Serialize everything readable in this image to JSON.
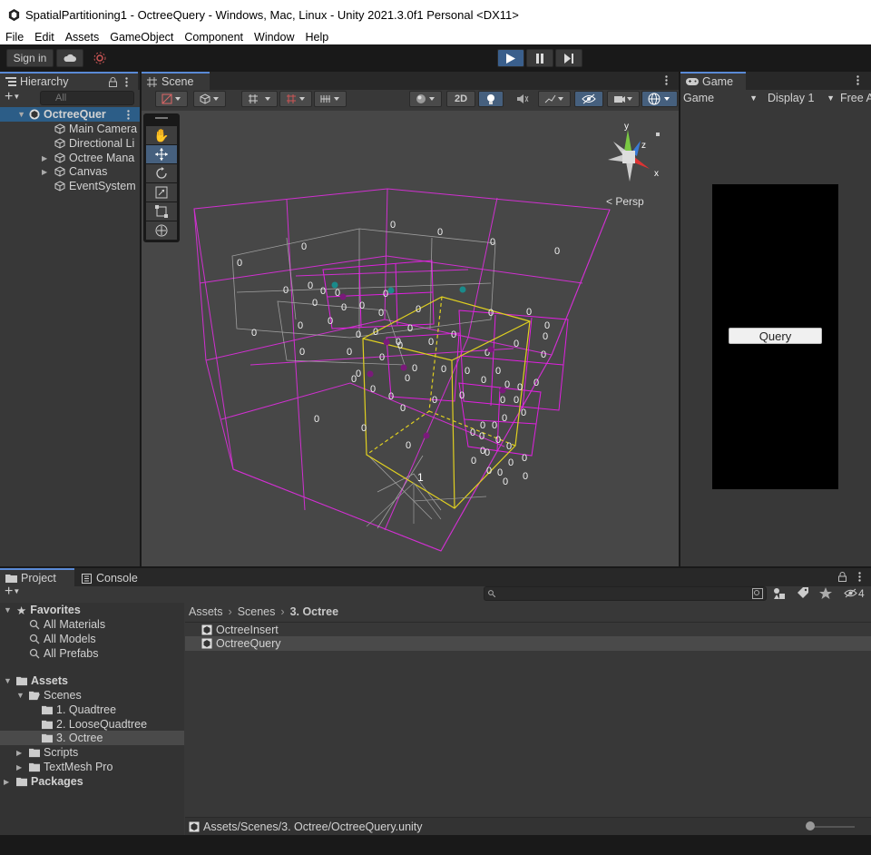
{
  "window": {
    "title": "SpatialPartitioning1 - OctreeQuery - Windows, Mac, Linux - Unity 2021.3.0f1 Personal <DX11>"
  },
  "menu": [
    "File",
    "Edit",
    "Assets",
    "GameObject",
    "Component",
    "Window",
    "Help"
  ],
  "toolbar": {
    "sign_in": "Sign in"
  },
  "hierarchy": {
    "tab": "Hierarchy",
    "search_placeholder": "All",
    "scene": "OctreeQuer",
    "items": [
      "Main Camera",
      "Directional Li",
      "Octree Mana",
      "Canvas",
      "EventSystem"
    ]
  },
  "scene": {
    "tab": "Scene",
    "btn_2d": "2D",
    "persp": "Persp",
    "gizmo": {
      "y": "y",
      "z": "z",
      "x": "x"
    },
    "labels": {
      "zero": "0",
      "one": "1"
    }
  },
  "game": {
    "tab": "Game",
    "dropdown": "Game",
    "display": "Display 1",
    "aspect": "Free A",
    "query_button": "Query"
  },
  "project": {
    "tab_project": "Project",
    "tab_console": "Console",
    "hidden_count": "4",
    "favorites_label": "Favorites",
    "favorites": [
      "All Materials",
      "All Models",
      "All Prefabs"
    ],
    "assets_label": "Assets",
    "scenes_label": "Scenes",
    "scene_folders": [
      "1. Quadtree",
      "2. LooseQuadtree",
      "3. Octree"
    ],
    "asset_folders": [
      "Scripts",
      "TextMesh Pro"
    ],
    "packages_label": "Packages",
    "breadcrumb": [
      "Assets",
      "Scenes",
      "3. Octree"
    ],
    "files": [
      "OctreeInsert",
      "OctreeQuery"
    ],
    "status_path": "Assets/Scenes/3. Octree/OctreeQuery.unity"
  },
  "colors": {
    "accent": "#3a5f8c",
    "selection": "#2c5d87",
    "octree_line": "#e020e0",
    "query_box": "#e0d020",
    "editor_bg": "#383838",
    "scene_bg": "#474747"
  }
}
